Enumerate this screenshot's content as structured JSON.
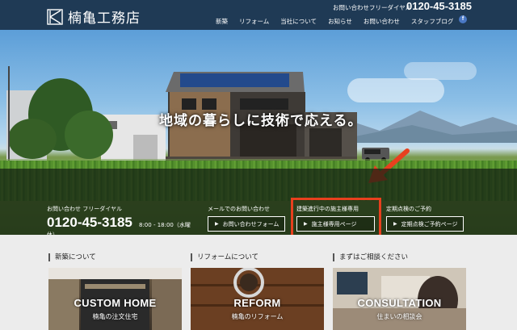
{
  "header": {
    "logo_text": "楠亀工務店",
    "phone_label": "お問い合わせフリーダイヤル",
    "phone_number": "0120-45-3185",
    "nav": [
      "新築",
      "リフォーム",
      "当社について",
      "お知らせ",
      "お問い合わせ",
      "スタッフブログ"
    ],
    "facebook": "f"
  },
  "hero": {
    "slogan": "地域の暮らしに技術で応える。"
  },
  "infobar": {
    "phone_label": "お問い合わせ フリーダイヤル",
    "phone_number": "0120-45-3185",
    "hours": "8:00 - 18:00（水曜",
    "hours_cont": "休）",
    "mail_label": "メールでのお問い合わせ",
    "mail_button": "お問い合わせフォーム",
    "owner_label": "建築進行中の施主様専用",
    "owner_button": "施主様専用ページ",
    "inspection_label": "定期点検のご予約",
    "inspection_button": "定期点検ご予約ページ"
  },
  "sections": [
    {
      "title": "新築について",
      "card_title": "CUSTOM HOME",
      "card_sub": "楠亀の注文住宅"
    },
    {
      "title": "リフォームについて",
      "card_title": "REFORM",
      "card_sub": "楠亀のリフォーム"
    },
    {
      "title": "まずはご相談ください",
      "card_title": "CONSULTATION",
      "card_sub": "住まいの相談会"
    }
  ],
  "colors": {
    "header_bg": "#1f3a55",
    "highlight": "#e8401e"
  }
}
